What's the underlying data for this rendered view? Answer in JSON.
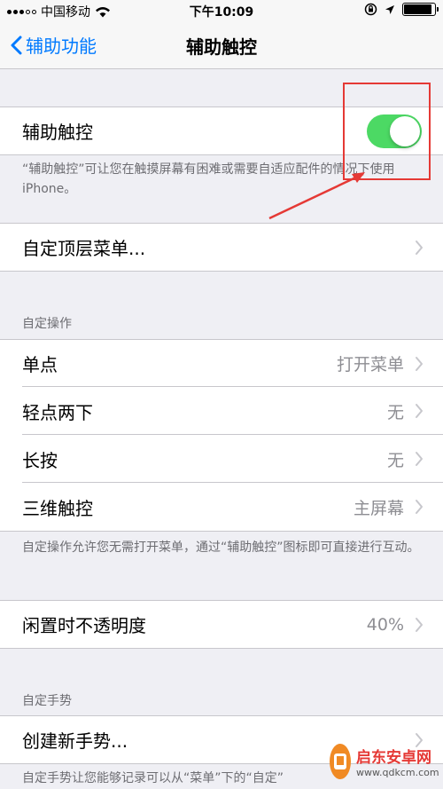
{
  "status_bar": {
    "carrier": "中国移动",
    "time": "下午10:09",
    "battery_level": 0.9,
    "icons": [
      "signal-dots-icon",
      "wifi-icon",
      "rotation-lock-icon",
      "location-icon",
      "battery-icon"
    ]
  },
  "nav": {
    "back_label": "辅助功能",
    "title": "辅助触控"
  },
  "assistive_touch": {
    "label": "辅助触控",
    "enabled": true,
    "accent_color": "#4cd964",
    "footer": "“辅助触控”可让您在触摸屏幕有困难或需要自适应配件的情况下使用 iPhone。"
  },
  "customize_menu": {
    "label": "自定顶层菜单..."
  },
  "custom_actions": {
    "header": "自定操作",
    "rows": [
      {
        "label": "单点",
        "value": "打开菜单"
      },
      {
        "label": "轻点两下",
        "value": "无"
      },
      {
        "label": "长按",
        "value": "无"
      },
      {
        "label": "三维触控",
        "value": "主屏幕"
      }
    ],
    "footer": "自定操作允许您无需打开菜单，通过“辅助触控”图标即可直接进行互动。"
  },
  "idle_opacity": {
    "label": "闲置时不透明度",
    "value": "40%"
  },
  "custom_gestures": {
    "header": "自定手势",
    "create_label": "创建新手势...",
    "footer": "自定手势让您能够记录可以从“菜单”下的“自定”"
  },
  "watermark": {
    "title": "启东安卓网",
    "url": "www.qdkcm.com"
  },
  "annotation_color": "#e53935"
}
